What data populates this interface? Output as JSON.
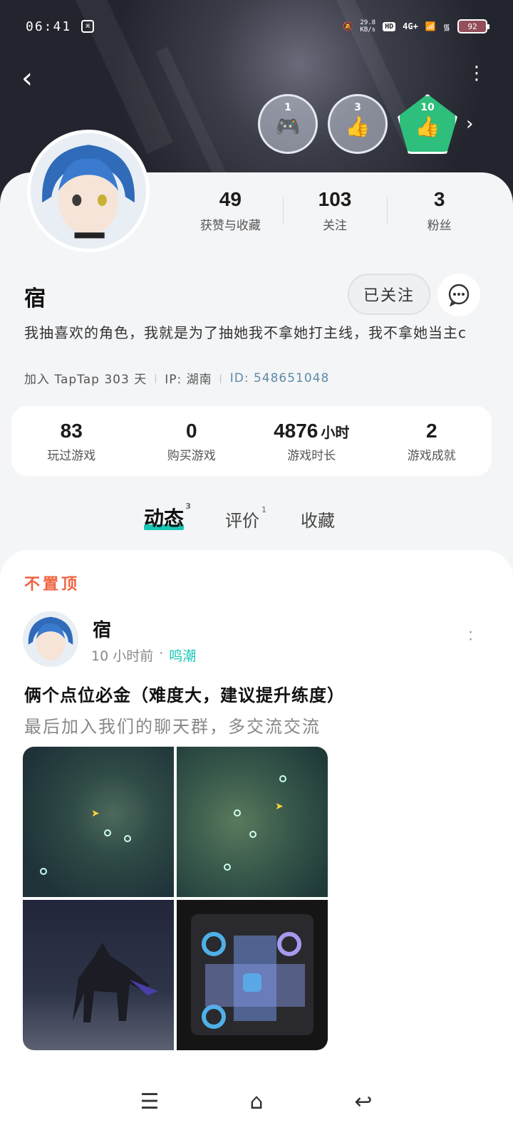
{
  "status_bar": {
    "time": "06:41",
    "speed_value": "29.8",
    "speed_unit": "KB/s",
    "hd": "HD",
    "network": "4G+",
    "battery": "92"
  },
  "header": {
    "badges": [
      {
        "num": "1",
        "icon": "controller-icon"
      },
      {
        "num": "3",
        "icon": "thumbs-up-icon"
      },
      {
        "num": "10",
        "icon": "thumbs-up-icon"
      }
    ]
  },
  "profile": {
    "stats": [
      {
        "value": "49",
        "label": "获赞与收藏"
      },
      {
        "value": "103",
        "label": "关注"
      },
      {
        "value": "3",
        "label": "粉丝"
      }
    ],
    "name": "宿",
    "follow_label": "已关注",
    "bio": "我抽喜欢的角色，我就是为了抽她我不拿她打主线，我不拿她当主c",
    "join": "加入 TapTap 303 天",
    "ip": "IP: 湖南",
    "id": "ID: 548651048"
  },
  "game_stats": [
    {
      "value": "83",
      "unit": "",
      "label": "玩过游戏"
    },
    {
      "value": "0",
      "unit": "",
      "label": "购买游戏"
    },
    {
      "value": "4876",
      "unit": "小时",
      "label": "游戏时长"
    },
    {
      "value": "2",
      "unit": "",
      "label": "游戏成就"
    }
  ],
  "tabs": [
    {
      "label": "动态",
      "count": "3",
      "active": true
    },
    {
      "label": "评价",
      "count": "1",
      "active": false
    },
    {
      "label": "收藏",
      "count": "",
      "active": false
    }
  ],
  "post": {
    "pinned": "不置顶",
    "author": "宿",
    "time": "10 小时前",
    "dot": "·",
    "game": "鸣潮",
    "title": "俩个点位必金（难度大，建议提升练度）",
    "body": "最后加入我们的聊天群，多交流交流"
  },
  "colors": {
    "accent": "#19c6b6",
    "pinned": "#f0633f",
    "id_color": "#5e8aa6"
  }
}
